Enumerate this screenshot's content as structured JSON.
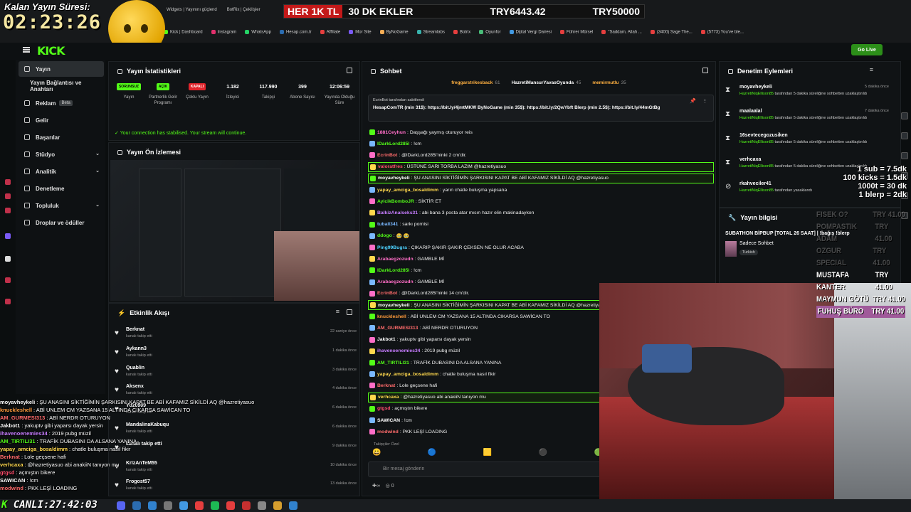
{
  "timer": {
    "label": "Kalan Yayın Süresi:",
    "value": "02:23:26"
  },
  "browser": {
    "tabs": [
      "Widgets | Yayınını güçlend",
      "BotRix | Çekilişler"
    ],
    "bookmarks": [
      "Kick | Dashboard",
      "Instagram",
      "WhatsApp",
      "Hesap.com.tr",
      "Affiliate",
      "Mor Site",
      "ByNoGame",
      "Streamlabs",
      "Botrix",
      "Oyunfor",
      "Dijital Vergi Dairesi",
      "Führer Mürsel",
      "\"Saddam, Allah ...",
      "(3400) Sage The...",
      "(5773) You've ble..."
    ]
  },
  "banner": {
    "red_text": "HER 1K TL",
    "offer": "30 DK EKLER",
    "current": "TRY6443.42",
    "goal": "TRY50000"
  },
  "kick": {
    "logo": "KICK",
    "go_live": "Go Live"
  },
  "sidebar": {
    "items": [
      {
        "label": "Yayın",
        "active": true
      },
      {
        "label": "Yayın Bağlantısı ve Anahtarı"
      },
      {
        "label": "Reklam",
        "badge": "Beta"
      },
      {
        "label": "Gelir"
      },
      {
        "label": "Başarılar"
      },
      {
        "label": "Stüdyo",
        "chev": "⌄"
      },
      {
        "label": "Analitik",
        "chev": "⌄"
      },
      {
        "label": "Denetleme"
      },
      {
        "label": "Topluluk",
        "chev": "⌄"
      },
      {
        "label": "Droplar ve ödüller"
      }
    ]
  },
  "stats": {
    "title": "Yayın İstatistikleri",
    "cols": [
      {
        "value": "SORUNSUZ",
        "label": "Yayın",
        "kind": "pill-green"
      },
      {
        "value": "AÇIK",
        "label": "Partnerlik Gelir Programı",
        "kind": "pill-green"
      },
      {
        "value": "KAPALI",
        "label": "Çoklu Yayın",
        "kind": "pill-red"
      },
      {
        "value": "1.182",
        "label": "İzleyici"
      },
      {
        "value": "117.990",
        "label": "Takipçi"
      },
      {
        "value": "399",
        "label": "Abone Sayısı"
      },
      {
        "value": "12:06:59",
        "label": "Yayında Olduğu Süre"
      }
    ],
    "connection": "Your connection has stabilised. Your stream will continue."
  },
  "preview": {
    "title": "Yayın Ön İzlemesi"
  },
  "activity": {
    "title": "Etkinlik Akışı",
    "rows": [
      {
        "name": "Berknat",
        "sub": "kanalı takip etti",
        "time": "22 saniye önce"
      },
      {
        "name": "Aykann3",
        "sub": "kanalı takip etti",
        "time": "1 dakika önce"
      },
      {
        "name": "Quablin",
        "sub": "kanalı takip etti",
        "time": "3 dakika önce"
      },
      {
        "name": "Aksenx",
        "sub": "kanalı takip etti",
        "time": "4 dakika önce"
      },
      {
        "name": "Ydz0909",
        "sub": "kanalı takip etti",
        "time": "6 dakika önce"
      },
      {
        "name": "MandalinaKabuqu",
        "sub": "kanalı takip etti",
        "time": "6 dakika önce"
      },
      {
        "name": "kanalı takip etti",
        "sub": "",
        "time": "9 dakika önce"
      },
      {
        "name": "KrIzAnTeM55",
        "sub": "kanalı takip etti",
        "time": "10 dakika önce"
      },
      {
        "name": "Frogost57",
        "sub": "kanalı takip etti",
        "time": "13 dakika önce"
      }
    ]
  },
  "chat": {
    "title": "Sohbet",
    "top_gifters": [
      {
        "name": "freggarstrikesback",
        "count": "61"
      },
      {
        "name": "HazretiMansurYavasOyunda",
        "count": "45"
      },
      {
        "name": "memirmutlu",
        "count": "35"
      }
    ],
    "pinned_header": "EcrinBot tarafından sabitlendi",
    "pinned_text": "HesapComTR (min 31$): https://bit.ly/4jmtMKW ByNoGame (min 35$): https://bit.ly/2QwYbft Blerp (min 2.5$): https://bit.ly/44mGtBg",
    "messages": [
      {
        "user": "1881Ceyhun",
        "color": "#ff6ec7",
        "text": "Daşşağı yaymış oturuyor reis"
      },
      {
        "user": "lDarkLord285l",
        "color": "#53fc18",
        "text": "!cm"
      },
      {
        "user": "EcrinBot",
        "color": "#ff6b6b",
        "text": "@lDarkLord285l'ninki 2 cm'dir."
      },
      {
        "user": "valoratfres",
        "color": "#ff4d6d",
        "text": "ÜSTÜNE SARI TORBA LAZIM @hazretiyasuo",
        "hl": true
      },
      {
        "user": "moyavheykeli",
        "color": "#ffffff",
        "text": "ŞU ANASINI SİKTİĞİMİN ŞARKISINI KAPAT BE ABİ KAFAMIZ SİKİLDİ AQ @hazretiyasuo",
        "hl": true
      },
      {
        "user": "yapay_amciga_bosaldimm",
        "color": "#ffd84d",
        "text": "yarın chatle buluşma yapsana"
      },
      {
        "user": "AyicikBomboJR",
        "color": "#53fc18",
        "text": "SİKTİR ET"
      },
      {
        "user": "BalkizAnalseks31",
        "color": "#c77dff",
        "text": "abi bana 3 posta atar mısın hazır elin makinadayken"
      },
      {
        "user": "tuball341",
        "color": "#7ab8ff",
        "text": "sarkı pornisi"
      },
      {
        "user": "ddogo",
        "color": "#53fc18",
        "text": "🥹 🥹"
      },
      {
        "user": "Ping99Bugra",
        "color": "#4dd2ff",
        "text": "ÇIKARIP ŞAKIR ŞAKIR ÇEKSEN NE OLUR ACABA"
      },
      {
        "user": "Arabaegzozudn",
        "color": "#ff6ec7",
        "text": "GAMBLE Mİ"
      },
      {
        "user": "lDarkLord285l",
        "color": "#53fc18",
        "text": "!cm"
      },
      {
        "user": "Arabaegzozudn",
        "color": "#ff6ec7",
        "text": "GAMBLE Mİ"
      },
      {
        "user": "EcrinBot",
        "color": "#ff6b6b",
        "text": "@lDarkLord285l'ninki 14 cm'dir."
      },
      {
        "user": "moyavheykeli",
        "color": "#ffffff",
        "text": "ŞU ANASINI SİKTİĞİMİN ŞARKISINI KAPAT BE ABİ KAFAMIZ SİKİLDİ AQ @hazretiyasuo",
        "hl": true
      },
      {
        "user": "knuckleshell",
        "color": "#ff9a3c",
        "text": "ABİ UNLEM CM YAZSANA 15 ALTINDA CIKARSA SAWİCAN TO"
      },
      {
        "user": "AM_GURMESI313",
        "color": "#ff6b6b",
        "text": "ABİ NERDR OTURUYON"
      },
      {
        "user": "Jakbot1",
        "color": "#ffffff",
        "text": "yakuptv gibi yaparsı dayak yersin"
      },
      {
        "user": "ihavenoenemies34",
        "color": "#c77dff",
        "text": "2019 pubg müzil"
      },
      {
        "user": "AM_TIRTILI31",
        "color": "#53fc18",
        "text": "TRAFİK DUBASINI DA ALSANA YANINA"
      },
      {
        "user": "yapay_amciga_bosaldimm",
        "color": "#ffd84d",
        "text": "chatle buluşma nasıl fikir"
      },
      {
        "user": "Berknat",
        "color": "#ff6b6b",
        "text": "Lole geçsene hafi"
      },
      {
        "user": "verhcaxa",
        "color": "#ffd84d",
        "text": "@hazretiyasuo abi anakiiN tanıyon mu",
        "hl": true
      },
      {
        "user": "gtgsd",
        "color": "#ff4d6d",
        "text": "açmıştın bikere"
      },
      {
        "user": "SAWICAN",
        "color": "#ffffff",
        "text": "!cm"
      },
      {
        "user": "modwind",
        "color": "#ff6b6b",
        "text": "PKK LEŞİ LOADING"
      }
    ],
    "top_label": "Takipçiler Özel",
    "input_placeholder": "Bir mesaj gönderin",
    "points": "0"
  },
  "mod": {
    "title": "Denetim Eylemleri",
    "rows": [
      {
        "icon": "⧗",
        "name": "moyavheykeli",
        "by": "HazretiNiqEllison85",
        "desc": " tarafından 5 dakika süreliğine sohbetten uzaklaştırıldı",
        "time": "5 dakika önce"
      },
      {
        "icon": "⧗",
        "name": "maalaalal",
        "by": "HazretiNiqEllison85",
        "desc": " tarafından 5 dakika süreliğine sohbetten uzaklaştırıldı",
        "time": "7 dakika önce"
      },
      {
        "icon": "⧗",
        "name": "16sevtecegozusiken",
        "by": "HazretiNiqEllison85",
        "desc": " tarafından 5 dakika süreliğine sohbetten uzaklaştırıldı",
        "time": ""
      },
      {
        "icon": "⧗",
        "name": "verhcaxa",
        "by": "HazretiNiqEllison85",
        "desc": " tarafından 5 dakika süreliğine sohbetten uzaklaştırıldı",
        "time": ""
      },
      {
        "icon": "⊘",
        "name": "rkahveciler41",
        "by": "HazretiNiqEllison85",
        "desc": " tarafından yasaklandı",
        "time": ""
      }
    ]
  },
  "info": {
    "title": "Yayın bilgisi",
    "stream_title": "SUBATHON BİPBUP [TOTAL 26 SAAT] | !bağış !blerp",
    "category": "Sadece Sohbet",
    "language": "Turkish"
  },
  "rates": [
    "1 sub = 7.5dk",
    "100 kicks = 1.5dk",
    "1000t = 30 dk",
    "1 blerp = 2dk"
  ],
  "goals": [
    {
      "name": "FISEK O?",
      "amount": "TRY 41.00",
      "cls": "f1"
    },
    {
      "name": "POMPASTIK ADAM",
      "amount": "TRY 41.00",
      "cls": "f1"
    },
    {
      "name": "OZGUR SPECIAL",
      "amount": "TRY 41.00",
      "cls": "f2"
    },
    {
      "name": "MUSTAFA KANTER",
      "amount": "TRY 41.00",
      "cls": ""
    },
    {
      "name": "MAYMUN GÖTÜ",
      "amount": "TRY 41.00",
      "cls": ""
    },
    {
      "name": "FUHUŞ BÜRO",
      "amount": "TRY 41.00",
      "cls": "hot"
    }
  ],
  "overlay_chat": [
    {
      "user": "moyavheykeli",
      "color": "#ffffff",
      "text": "ŞU ANASINI SİKTİĞİMİN ŞARKISINI KAPAT BE ABİ KAFAMIZ SİKİLDİ AQ @hazretiyasuo"
    },
    {
      "user": "knuckleshell",
      "color": "#ff9a3c",
      "text": "ABİ UNLEM CM YAZSANA 15 ALTINDA CIKARSA SAWİCAN TO"
    },
    {
      "user": "AM_GURMESI313",
      "color": "#ff6b6b",
      "text": "ABİ NERDR OTURUYON"
    },
    {
      "user": "Jakbot1",
      "color": "#ffffff",
      "text": "yakuptv gibi yaparsı dayak yersin"
    },
    {
      "user": "ihavenoenemies34",
      "color": "#c77dff",
      "text": "2019 pubg müzil"
    },
    {
      "user": "AM_TIRTILI31",
      "color": "#53fc18",
      "text": "TRAFİK DUBASINI DA ALSANA YANINA"
    },
    {
      "user": "yapay_amciga_bosaldimm",
      "color": "#ffd84d",
      "text": "chatle buluşma nasıl fikir"
    },
    {
      "user": "Berknat",
      "color": "#ff6b6b",
      "text": "Lole geçsene hafi"
    },
    {
      "user": "verhcaxa",
      "color": "#ffd84d",
      "text": "@hazretiyasuo abi anakiiN tanıyon mu"
    },
    {
      "user": "gtgsd",
      "color": "#ff4d6d",
      "text": "açmıştın bikere"
    },
    {
      "user": "SAWICAN",
      "color": "#ffffff",
      "text": "!cm"
    },
    {
      "user": "modwind",
      "color": "#ff6b6b",
      "text": "PKK LEŞİ LOADING"
    }
  ],
  "live_counter": {
    "label": "CANLI:",
    "value": "27:42:03"
  },
  "colors": {
    "kick_green": "#53fc18",
    "panel_bg": "#101315",
    "highlight_border": "#53fc18"
  }
}
